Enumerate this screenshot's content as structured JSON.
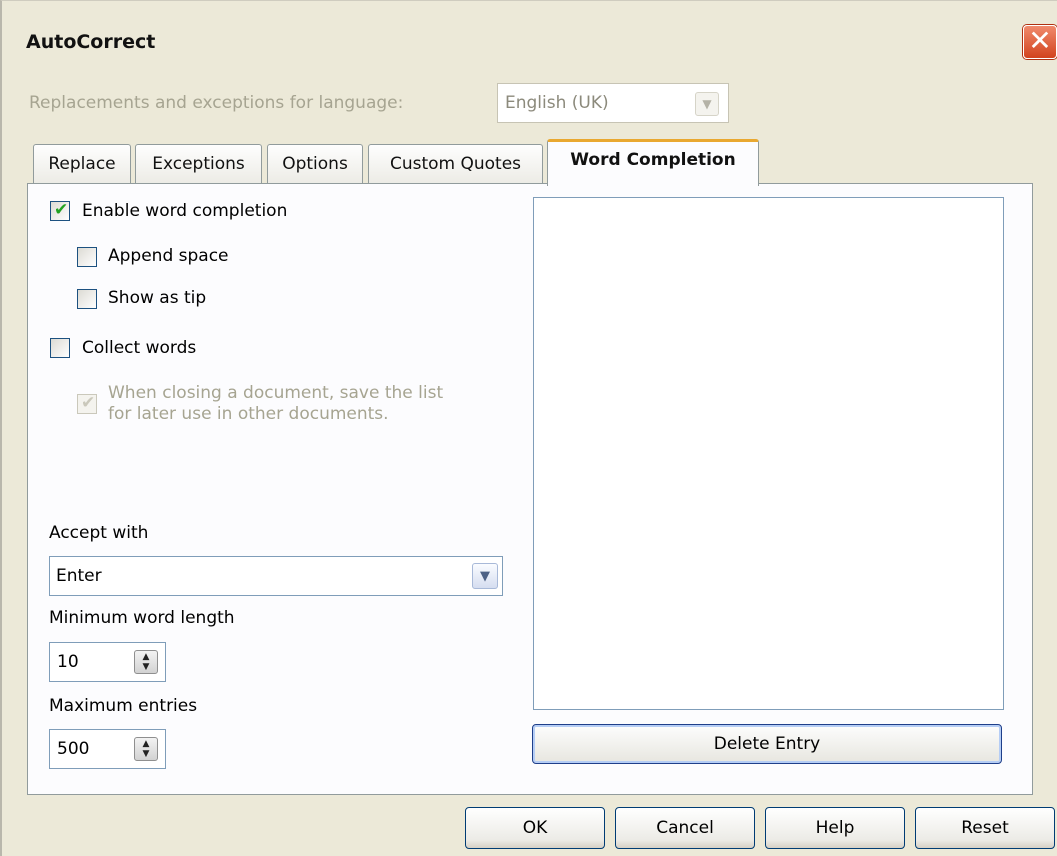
{
  "dialog": {
    "title": "AutoCorrect",
    "close_glyph": "✕"
  },
  "language": {
    "label": "Replacements and exceptions for language:",
    "value": "English (UK)"
  },
  "tabs": [
    {
      "label": "Replace"
    },
    {
      "label": "Exceptions"
    },
    {
      "label": "Options"
    },
    {
      "label": "Custom Quotes"
    },
    {
      "label": "Word Completion",
      "active": true
    }
  ],
  "options": {
    "enable_word_completion": {
      "label": "Enable word completion",
      "checked": true
    },
    "append_space": {
      "label": "Append space",
      "checked": false
    },
    "show_as_tip": {
      "label": "Show as tip",
      "checked": false
    },
    "collect_words": {
      "label": "Collect words",
      "checked": false
    },
    "save_list": {
      "label_line1": "When closing a document, save the list",
      "label_line2": "for later use in other documents.",
      "checked": true,
      "disabled": true
    }
  },
  "accept_with": {
    "label": "Accept with",
    "value": "Enter"
  },
  "min_word_length": {
    "label": "Minimum word length",
    "value": "10"
  },
  "max_entries": {
    "label": "Maximum entries",
    "value": "500"
  },
  "word_list": {
    "items": []
  },
  "buttons": {
    "delete_entry": "Delete Entry",
    "ok": "OK",
    "cancel": "Cancel",
    "help": "Help",
    "reset": "Reset"
  },
  "glyphs": {
    "check": "✔",
    "dropdown": "▼",
    "spin_up": "▲",
    "spin_down": "▼"
  },
  "colors": {
    "dialog_bg": "#ece9d8",
    "active_tab_accent": "#e9a830",
    "check_mark": "#21a121",
    "close_button": "#d2431e",
    "disabled_text": "#a6a491"
  }
}
